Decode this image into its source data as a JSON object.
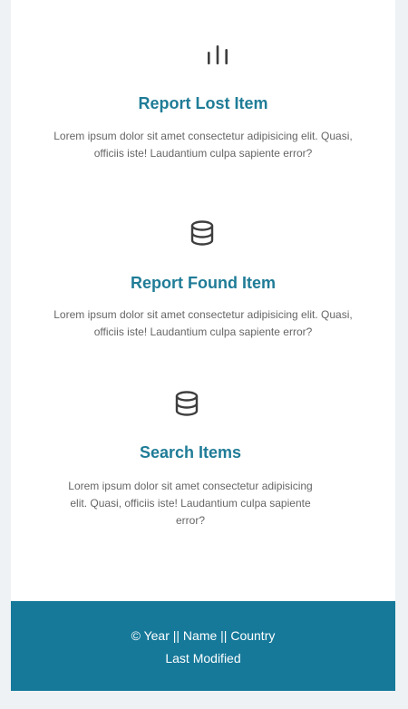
{
  "features": [
    {
      "icon": "bar-chart-icon",
      "title": "Report Lost Item",
      "description": "Lorem ipsum dolor sit amet consectetur adipisicing elit. Quasi, officiis iste! Laudantium culpa sapiente error?"
    },
    {
      "icon": "database-icon",
      "title": "Report Found Item",
      "description": "Lorem ipsum dolor sit amet consectetur adipisicing elit. Quasi, officiis iste! Laudantium culpa sapiente error?"
    },
    {
      "icon": "database-icon",
      "title": "Search Items",
      "description": "Lorem ipsum dolor sit amet consectetur adipisicing elit. Quasi, officiis iste! Laudantium culpa sapiente error?"
    }
  ],
  "footer": {
    "copyright": "© Year || Name || Country",
    "last_modified": "Last Modified"
  },
  "colors": {
    "accent": "#1f7c97",
    "footer_background": "#16799a",
    "page_background": "#eef2f4",
    "body_text": "#666666",
    "icon": "#3e3e3e"
  }
}
